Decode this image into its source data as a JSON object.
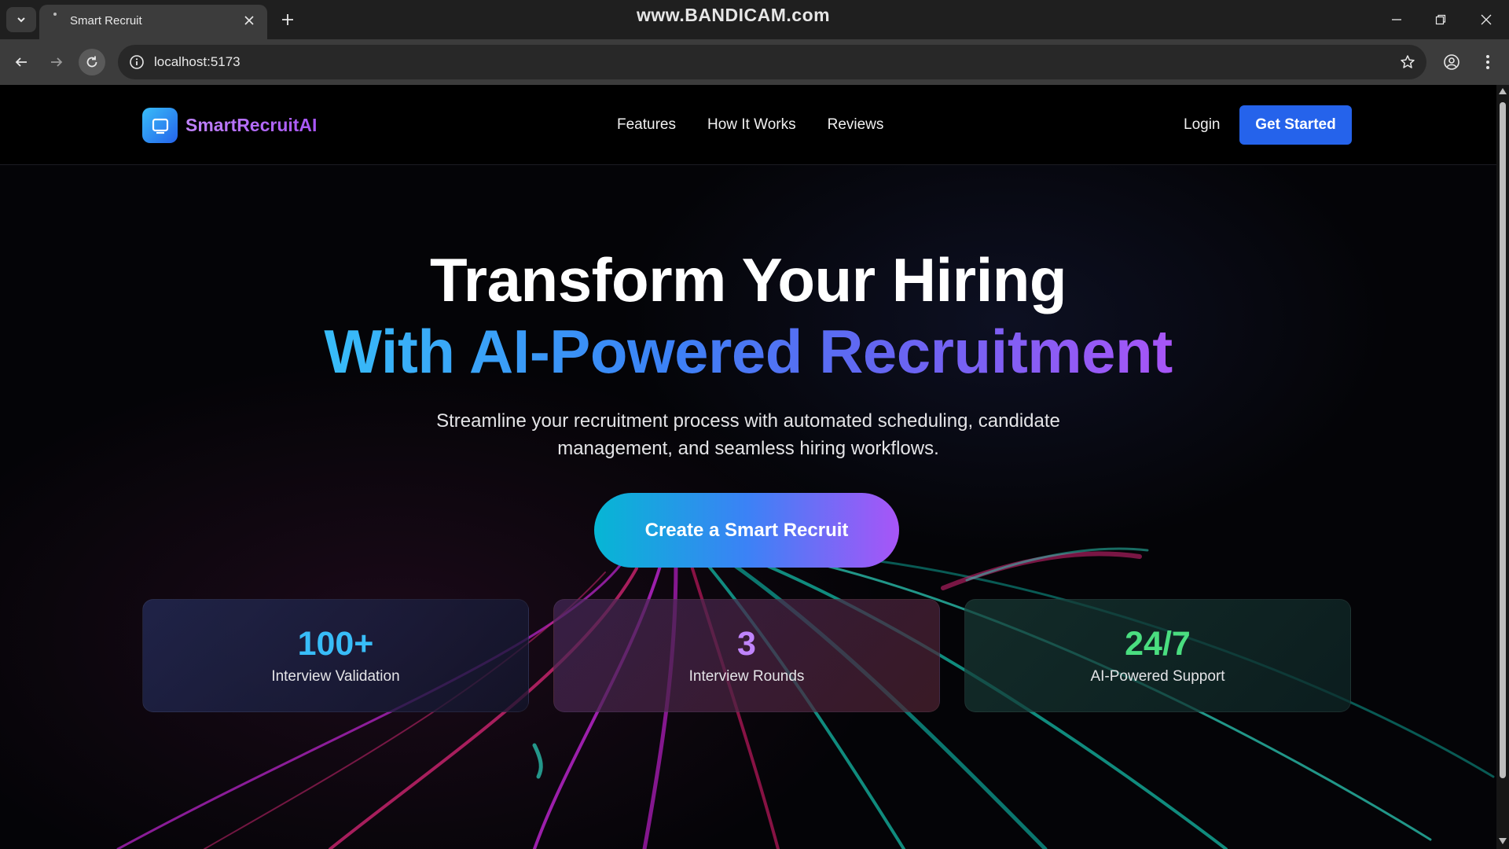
{
  "browser": {
    "tab_title": "Smart Recruit",
    "url": "localhost:5173",
    "watermark": "www.BANDICAM.com"
  },
  "nav": {
    "brand": "SmartRecruitAI",
    "links": [
      "Features",
      "How It Works",
      "Reviews"
    ],
    "login": "Login",
    "cta": "Get Started"
  },
  "hero": {
    "title_line1": "Transform Your Hiring",
    "title_line2": "With AI-Powered Recruitment",
    "subtitle": "Streamline your recruitment process with automated scheduling, candidate management, and seamless hiring workflows.",
    "cta": "Create a Smart Recruit"
  },
  "stats": [
    {
      "value": "100+",
      "label": "Interview Validation",
      "color": "#38bdf8"
    },
    {
      "value": "3",
      "label": "Interview Rounds",
      "color": "#c084fc"
    },
    {
      "value": "24/7",
      "label": "AI-Powered Support",
      "color": "#4ade80"
    }
  ],
  "colors": {
    "primary_button": "#2563eb",
    "brand_text": "#a855f7",
    "gradient_start": "#06b6d4",
    "gradient_end": "#a855f7"
  }
}
